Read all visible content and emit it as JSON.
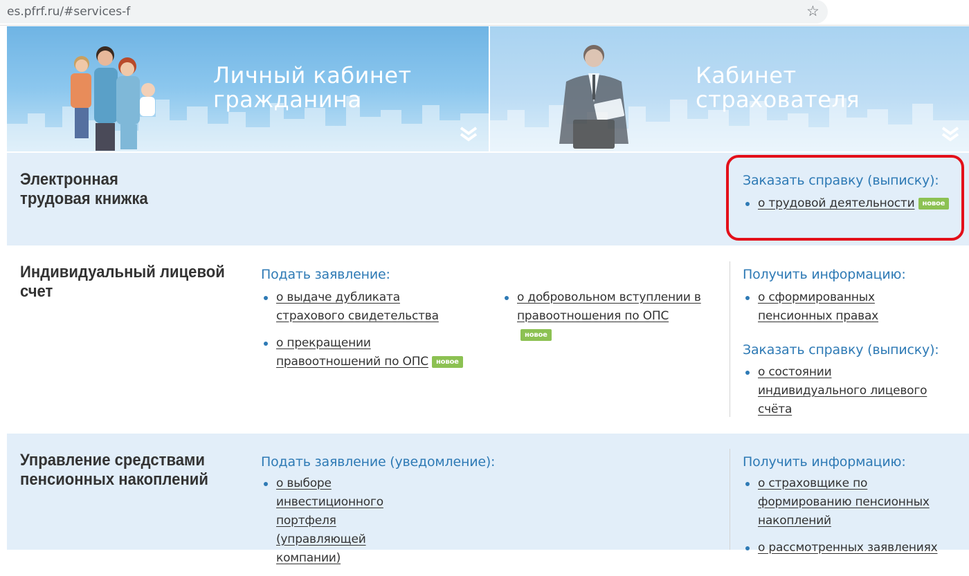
{
  "browser": {
    "url": "es.pfrf.ru/#services-f",
    "star_icon": "☆"
  },
  "banners": [
    {
      "title_line1": "Личный кабинет",
      "title_line2": "гражданина"
    },
    {
      "title_line1": "Кабинет",
      "title_line2": "страхователя"
    }
  ],
  "chevron_glyph": "︾",
  "badge_text": "новое",
  "etk": {
    "title_line1": "Электронная",
    "title_line2": "трудовая книжка",
    "order_title": "Заказать справку (выписку):",
    "order_links": [
      "о трудовой деятельности"
    ]
  },
  "ils": {
    "title_line1": "Индивидуальный лицевой",
    "title_line2": "счет",
    "apply_title": "Подать заявление:",
    "apply_links": [
      "о выдаче дубликата страхового свидетельства",
      "о прекращении правоотношений по ОПС",
      "о добровольном вступлении в правоотношения по ОПС"
    ],
    "info_title": "Получить информацию:",
    "info_links": [
      "о сформированных пенсионных правах"
    ],
    "order_title": "Заказать справку (выписку):",
    "order_links": [
      "о состоянии индивидуального лицевого счёта"
    ]
  },
  "upn": {
    "title_line1": "Управление средствами",
    "title_line2": "пенсионных накоплений",
    "apply_title": "Подать заявление (уведомление):",
    "apply_links": [
      "о выборе инвестиционного портфеля (управляющей компании)"
    ],
    "info_title": "Получить информацию:",
    "info_links": [
      "о страховщике по формированию пенсионных накоплений",
      "о рассмотренных заявлениях"
    ]
  },
  "colors": {
    "accent_blue": "#2e7ab5",
    "section_bg": "#e2eef9",
    "badge_green": "#8cc152",
    "highlight_red": "#e3101a"
  }
}
